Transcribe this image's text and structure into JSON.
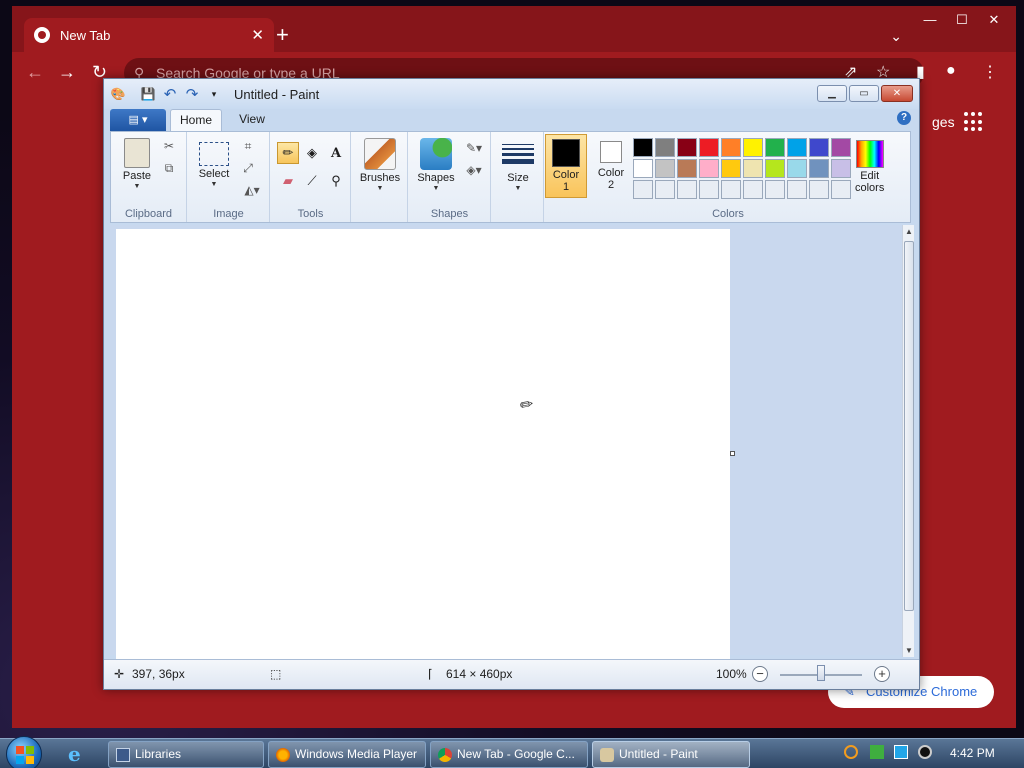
{
  "chrome": {
    "tab_title": "New Tab",
    "omnibox_placeholder": "Search Google or type a URL",
    "apps_label": "ges",
    "customize_label": "Customize Chrome"
  },
  "paint": {
    "title": "Untitled - Paint",
    "tabs": {
      "home": "Home",
      "view": "View"
    },
    "groups": {
      "clipboard": "Clipboard",
      "image": "Image",
      "tools": "Tools",
      "shapes": "Shapes",
      "colors": "Colors"
    },
    "buttons": {
      "paste": "Paste",
      "select": "Select",
      "brushes": "Brushes",
      "shapes": "Shapes",
      "size": "Size",
      "color1_line1": "Color",
      "color1_line2": "1",
      "color2_line1": "Color",
      "color2_line2": "2",
      "edit_colors_line1": "Edit",
      "edit_colors_line2": "colors"
    },
    "color1": "#000000",
    "color2": "#ffffff",
    "palette": [
      "#000000",
      "#7f7f7f",
      "#880015",
      "#ed1c24",
      "#ff7f27",
      "#fff200",
      "#22b14c",
      "#00a2e8",
      "#3f48cc",
      "#a349a4",
      "#ffffff",
      "#c3c3c3",
      "#b97a57",
      "#ffaec9",
      "#ffc90e",
      "#efe4b0",
      "#b5e61d",
      "#99d9ea",
      "#7092be",
      "#c8bfe7",
      "#e8edf4",
      "#e8edf4",
      "#e8edf4",
      "#e8edf4",
      "#e8edf4",
      "#e8edf4",
      "#e8edf4",
      "#e8edf4",
      "#e8edf4",
      "#e8edf4"
    ],
    "status": {
      "cursor_pos": "397, 36px",
      "canvas_size": "614 × 460px",
      "zoom": "100%"
    }
  },
  "taskbar": {
    "items": [
      {
        "label": "Libraries"
      },
      {
        "label": "Windows Media Player"
      },
      {
        "label": "New Tab - Google C..."
      },
      {
        "label": "Untitled - Paint"
      }
    ],
    "clock": "4:42 PM"
  }
}
